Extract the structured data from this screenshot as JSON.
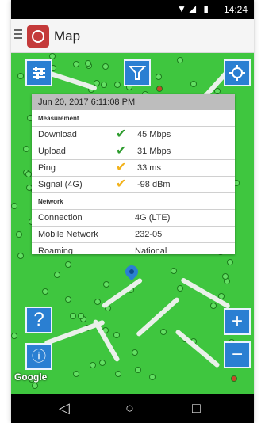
{
  "status_bar": {
    "time": "14:24",
    "indicators": [
      "wifi-icon",
      "signal-icon",
      "battery-icon"
    ]
  },
  "app_bar": {
    "title": "Map",
    "logo": "stopwatch-logo-icon"
  },
  "map": {
    "attribution": "Google",
    "controls": {
      "filter_icon": "filter-icon",
      "settings_icon": "sliders-icon",
      "locate_icon": "crosshair-icon",
      "help_label": "?",
      "info_label": "ⓘ",
      "zoom_in_label": "+",
      "zoom_out_label": "−"
    }
  },
  "popup": {
    "datetime": "Jun 20, 2017 6:11:08 PM",
    "measurement": {
      "section_label": "Measurement",
      "rows": [
        {
          "label": "Download",
          "status": "good",
          "value": "45 Mbps"
        },
        {
          "label": "Upload",
          "status": "good",
          "value": "31 Mbps"
        },
        {
          "label": "Ping",
          "status": "medium",
          "value": "33 ms"
        },
        {
          "label": "Signal (4G)",
          "status": "medium",
          "value": "-98 dBm"
        }
      ]
    },
    "network": {
      "section_label": "Network",
      "rows": [
        {
          "label": "Connection",
          "value": "4G (LTE)"
        },
        {
          "label": "Mobile Network",
          "value": "232-05"
        },
        {
          "label": "Roaming",
          "value": "National"
        }
      ]
    }
  },
  "colors": {
    "map_green": "#3fc63f",
    "fab_blue": "#2a7fd2",
    "check_green": "#2e9c2e",
    "check_yellow": "#f2b21b"
  },
  "nav_bar": {
    "back": "◁",
    "home": "○",
    "recents": "□"
  }
}
